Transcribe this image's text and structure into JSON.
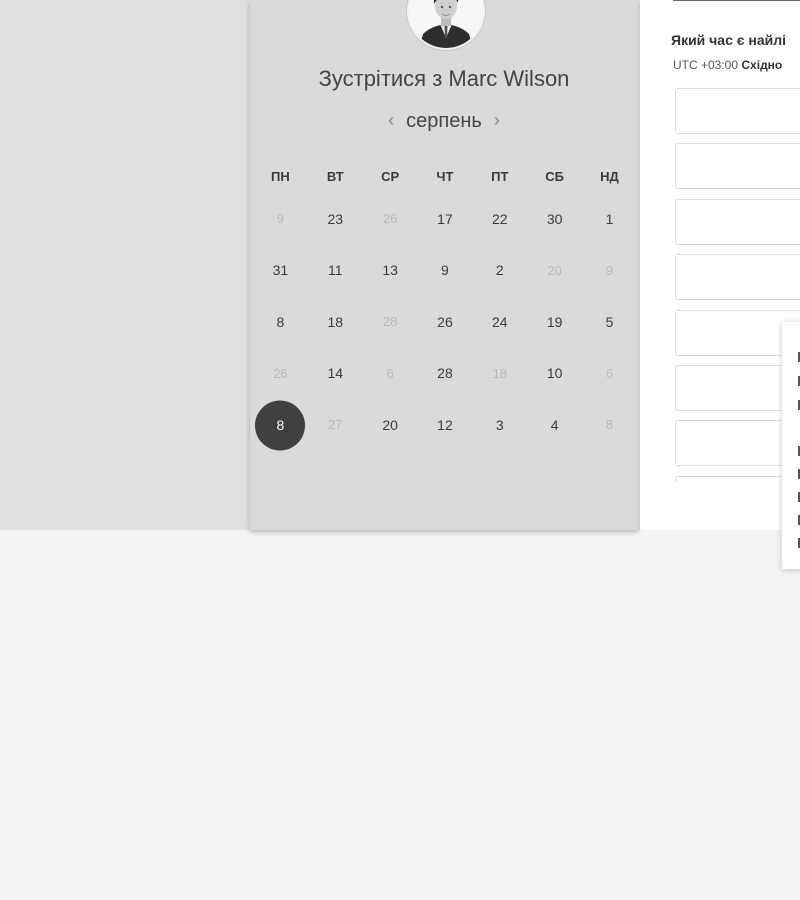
{
  "booking": {
    "title": "Зустрітися з Marc Wilson",
    "month": "серпень",
    "prev_icon": "‹",
    "next_icon": "›"
  },
  "calendar": {
    "weekdays": [
      "ПН",
      "ВТ",
      "СР",
      "ЧТ",
      "ПТ",
      "СБ",
      "НД"
    ],
    "weeks": [
      [
        {
          "d": "9",
          "muted": true
        },
        {
          "d": "23"
        },
        {
          "d": "26",
          "muted": true
        },
        {
          "d": "17"
        },
        {
          "d": "22"
        },
        {
          "d": "30"
        },
        {
          "d": "1"
        }
      ],
      [
        {
          "d": "31"
        },
        {
          "d": "11"
        },
        {
          "d": "13"
        },
        {
          "d": "9"
        },
        {
          "d": "2"
        },
        {
          "d": "20",
          "muted": true
        },
        {
          "d": "9",
          "muted": true
        }
      ],
      [
        {
          "d": "8"
        },
        {
          "d": "18"
        },
        {
          "d": "28",
          "muted": true
        },
        {
          "d": "26"
        },
        {
          "d": "24"
        },
        {
          "d": "19"
        },
        {
          "d": "5"
        }
      ],
      [
        {
          "d": "26",
          "muted": true
        },
        {
          "d": "14"
        },
        {
          "d": "6",
          "muted": true
        },
        {
          "d": "28"
        },
        {
          "d": "18",
          "muted": true
        },
        {
          "d": "10"
        },
        {
          "d": "6",
          "muted": true
        }
      ],
      [
        {
          "d": "8",
          "selected": true
        },
        {
          "d": "27",
          "muted": true
        },
        {
          "d": "20"
        },
        {
          "d": "12"
        },
        {
          "d": "3"
        },
        {
          "d": "4"
        },
        {
          "d": "8",
          "muted": true
        }
      ]
    ]
  },
  "times": {
    "question": "Який час є найлі",
    "tz_offset": "UTC +03:00",
    "tz_name": "Східно",
    "slot_count_visible": 8
  },
  "colors": {
    "selected_day": "#404040",
    "card_bg": "#dadada"
  }
}
